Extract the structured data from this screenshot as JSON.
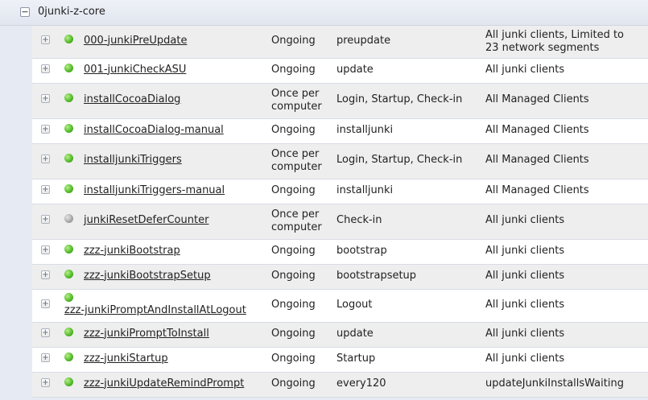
{
  "group": {
    "title": "0junki-z-core",
    "collapse_symbol": "−"
  },
  "expand_symbol": "+",
  "policies": [
    {
      "name": "000-junkiPreUpdate",
      "status": "green",
      "frequency": "Ongoing",
      "trigger": "preupdate",
      "scope": "All junki clients, Limited to 23 network segments"
    },
    {
      "name": "001-junkiCheckASU",
      "status": "green",
      "frequency": "Ongoing",
      "trigger": "update",
      "scope": "All junki clients"
    },
    {
      "name": "installCocoaDialog",
      "status": "green",
      "frequency": "Once per computer",
      "trigger": "Login, Startup, Check-in",
      "scope": "All Managed Clients"
    },
    {
      "name": "installCocoaDialog-manual",
      "status": "green",
      "frequency": "Ongoing",
      "trigger": "installjunki",
      "scope": "All Managed Clients"
    },
    {
      "name": "installjunkiTriggers",
      "status": "green",
      "frequency": "Once per computer",
      "trigger": "Login, Startup, Check-in",
      "scope": "All Managed Clients"
    },
    {
      "name": "installjunkiTriggers-manual",
      "status": "green",
      "frequency": "Ongoing",
      "trigger": "installjunki",
      "scope": "All Managed Clients"
    },
    {
      "name": "junkiResetDeferCounter",
      "status": "gray",
      "frequency": "Once per computer",
      "trigger": "Check-in",
      "scope": "All junki clients"
    },
    {
      "name": "zzz-junkiBootstrap",
      "status": "green",
      "frequency": "Ongoing",
      "trigger": "bootstrap",
      "scope": "All junki clients"
    },
    {
      "name": "zzz-junkiBootstrapSetup",
      "status": "green",
      "frequency": "Ongoing",
      "trigger": "bootstrapsetup",
      "scope": "All junki clients"
    },
    {
      "name": "zzz-junkiPromptAndInstallAtLogout",
      "status": "green",
      "frequency": "Ongoing",
      "trigger": "Logout",
      "scope": "All junki clients"
    },
    {
      "name": "zzz-junkiPromptToInstall",
      "status": "green",
      "frequency": "Ongoing",
      "trigger": "update",
      "scope": "All junki clients"
    },
    {
      "name": "zzz-junkiStartup",
      "status": "green",
      "frequency": "Ongoing",
      "trigger": "Startup",
      "scope": "All junki clients"
    },
    {
      "name": "zzz-junkiUpdateRemindPrompt",
      "status": "green",
      "frequency": "Ongoing",
      "trigger": "every120",
      "scope": "updateJunkiInstallsWaiting"
    }
  ]
}
